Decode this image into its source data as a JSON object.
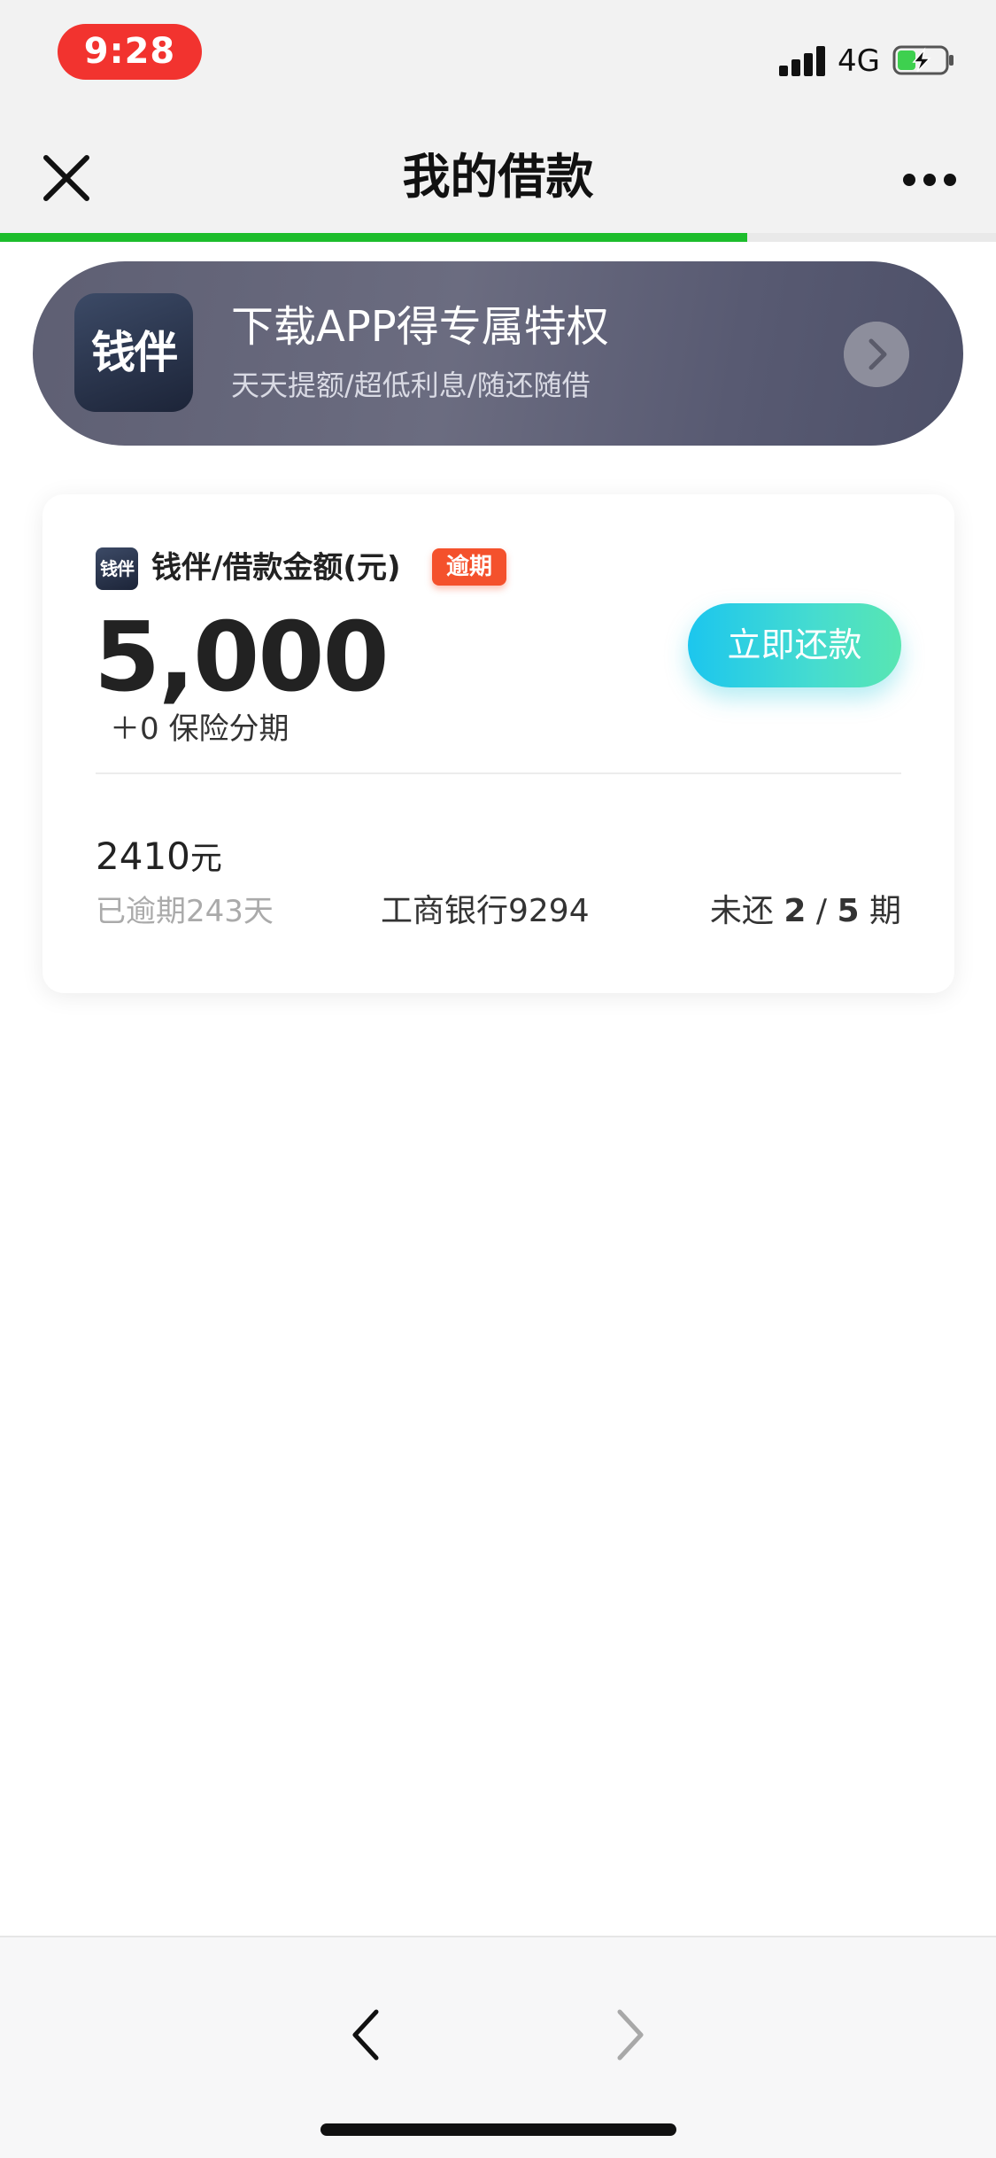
{
  "status_bar": {
    "time": "9:28",
    "network": "4G"
  },
  "nav": {
    "title": "我的借款",
    "progress_fraction": 0.75
  },
  "promo": {
    "app_icon_text": "钱伴",
    "title": "下载APP得专属特权",
    "subtitle": "天天提额/超低利息/随还随借"
  },
  "loan": {
    "brand_icon_text": "钱伴",
    "label": "钱伴/借款金额(元)",
    "badge": "逾期",
    "amount": "5,000",
    "insurance": "＋0 保险分期",
    "repay_button": "立即还款",
    "due_amount": "2410",
    "due_unit": "元",
    "overdue_days": "已逾期243天",
    "bank": "工商银行9294",
    "periods_prefix": "未还",
    "periods_remaining": "2",
    "periods_separator": "/",
    "periods_total": "5",
    "periods_suffix": "期"
  },
  "colors": {
    "time_pill": "#f2332f",
    "progress": "#1dbd2c",
    "badge": "#f4512c",
    "repay_start": "#1cc6ee",
    "repay_end": "#58e6b2"
  },
  "icons": {
    "close": "close-icon",
    "more": "more-icon",
    "promo_arrow": "chevron-right-icon",
    "back": "chevron-left-icon",
    "forward": "chevron-right-icon"
  }
}
